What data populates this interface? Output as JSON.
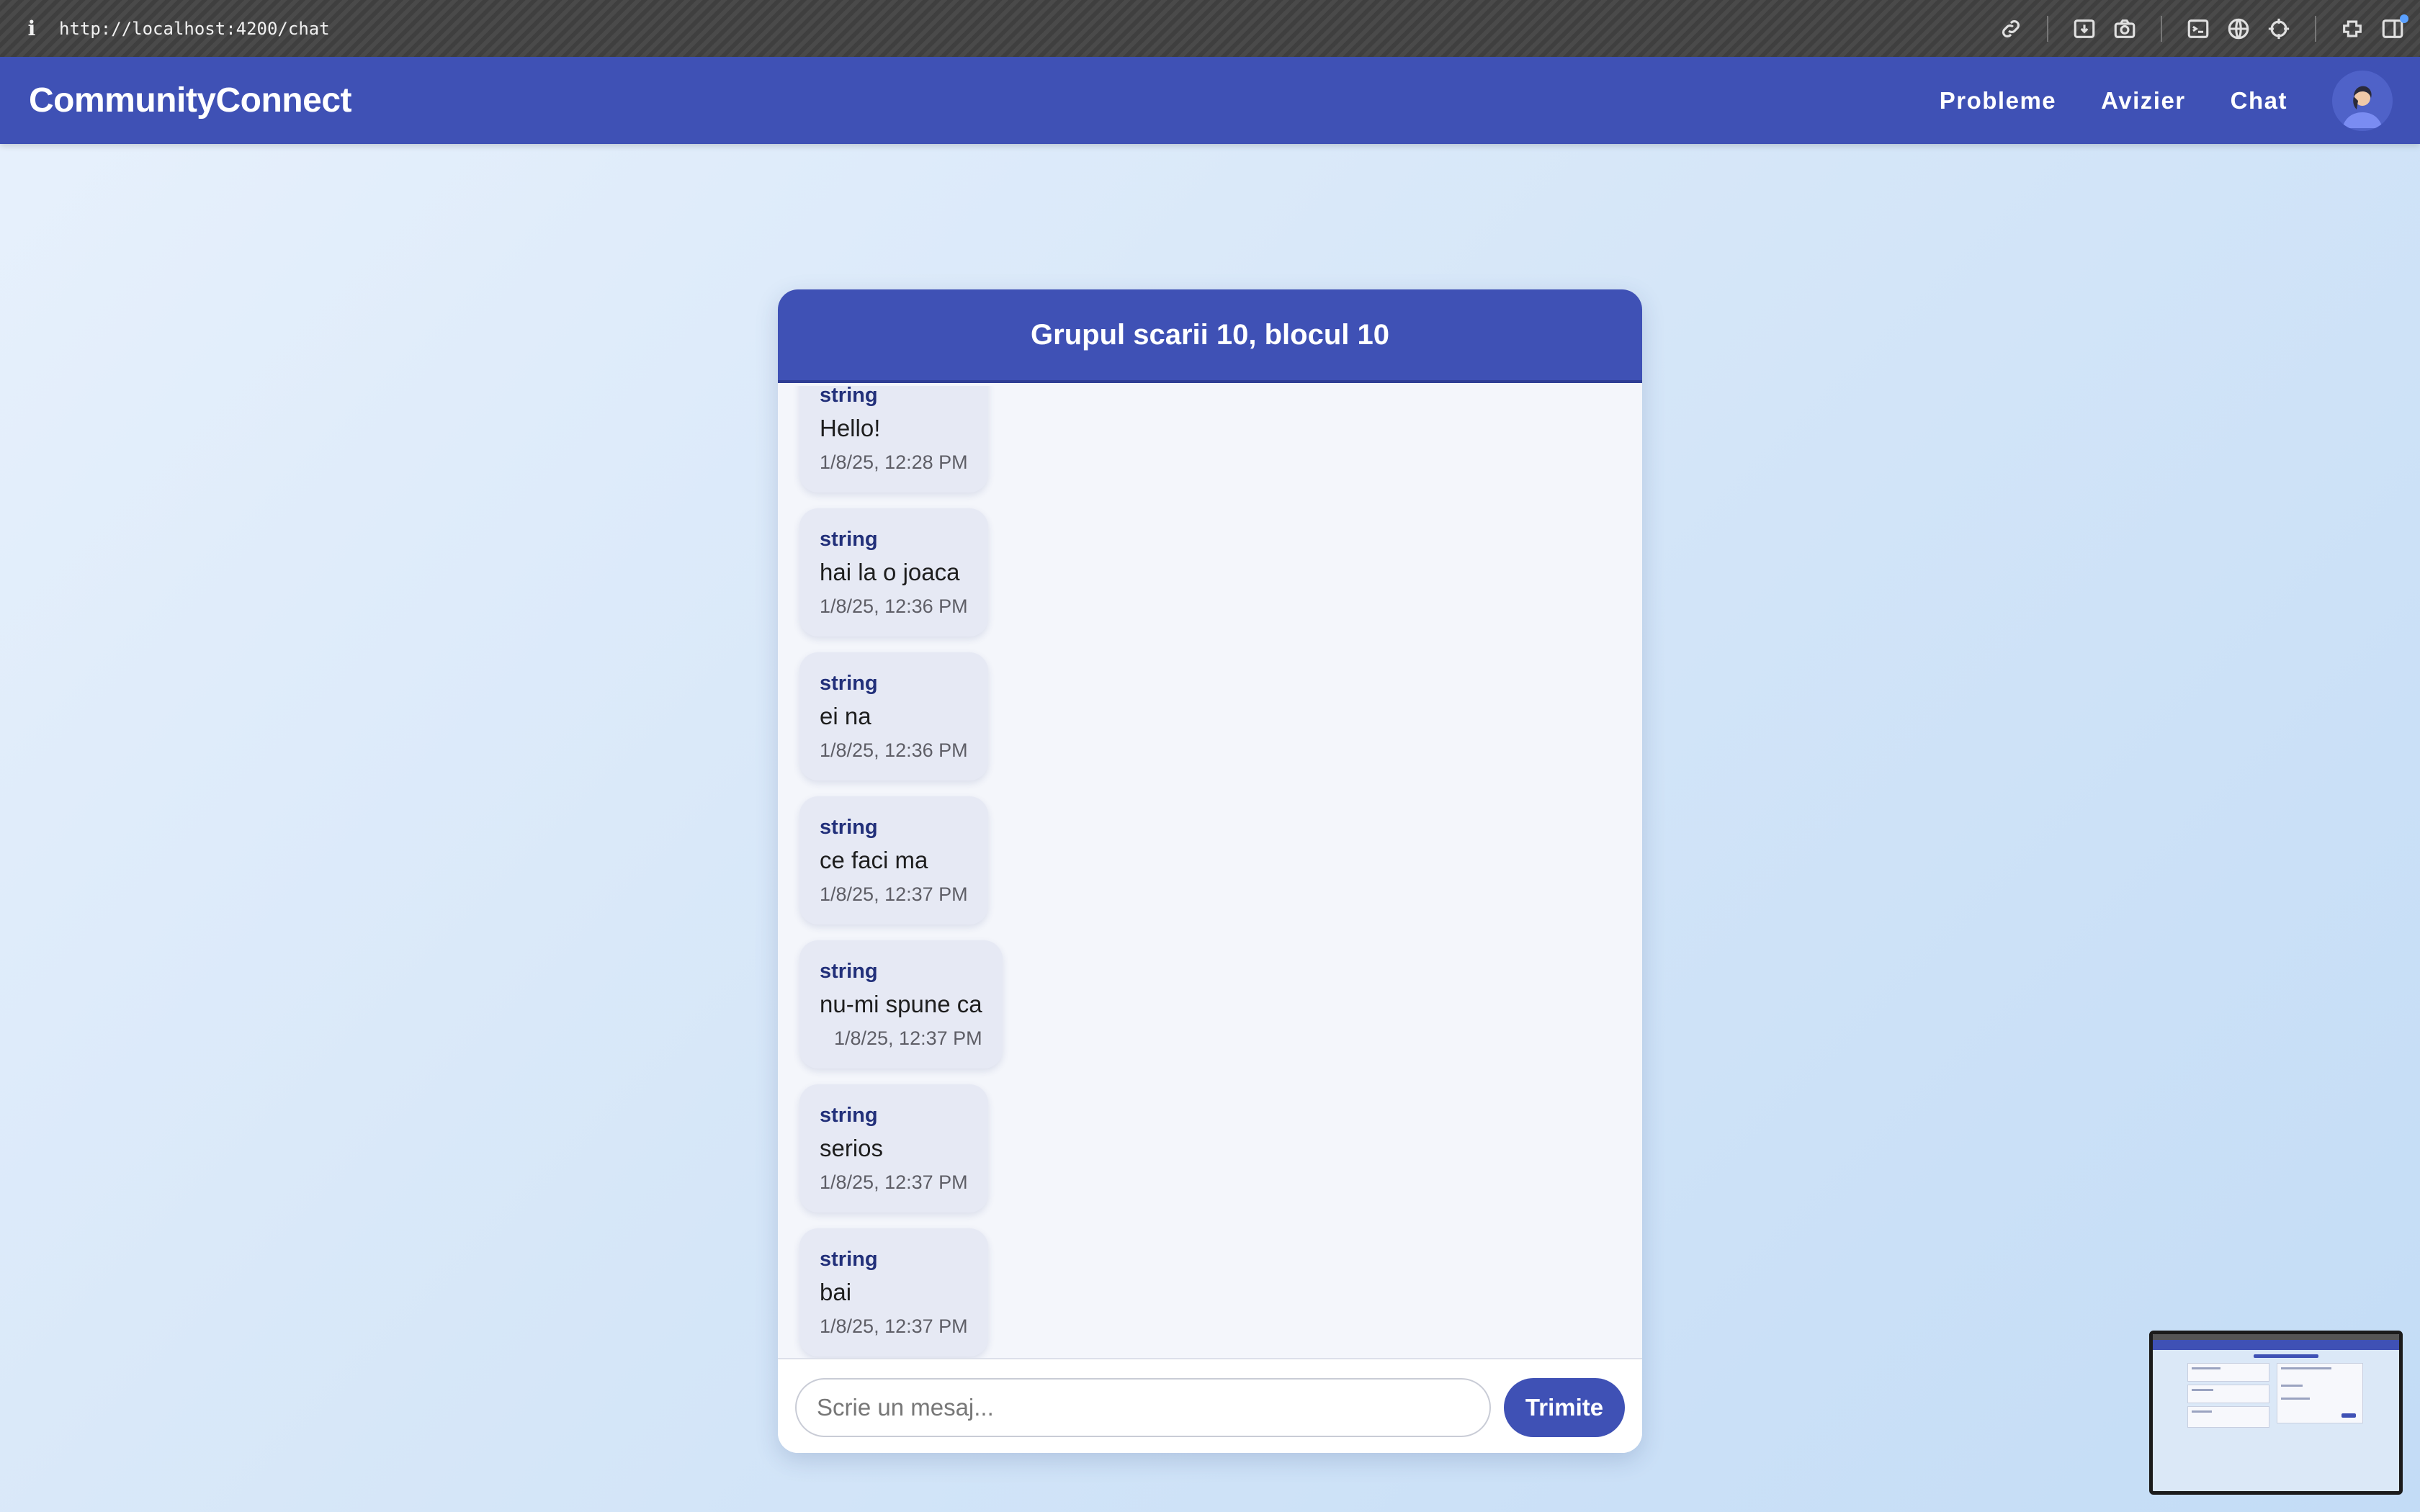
{
  "browser": {
    "url": "http://localhost:4200/chat",
    "info_icon": "i"
  },
  "app": {
    "brand": "CommunityConnect",
    "nav": [
      "Probleme",
      "Avizier",
      "Chat"
    ]
  },
  "chat": {
    "title": "Grupul scarii 10, blocul 10",
    "messages": [
      {
        "sender": "string",
        "text": "Hello!",
        "time": "1/8/25, 12:28 PM"
      },
      {
        "sender": "string",
        "text": "hai la o joaca",
        "time": "1/8/25, 12:36 PM"
      },
      {
        "sender": "string",
        "text": "ei na",
        "time": "1/8/25, 12:36 PM"
      },
      {
        "sender": "string",
        "text": "ce faci ma",
        "time": "1/8/25, 12:37 PM"
      },
      {
        "sender": "string",
        "text": "nu-mi spune ca",
        "time": "1/8/25, 12:37 PM"
      },
      {
        "sender": "string",
        "text": "serios",
        "time": "1/8/25, 12:37 PM"
      },
      {
        "sender": "string",
        "text": "bai",
        "time": "1/8/25, 12:37 PM"
      }
    ],
    "input_placeholder": "Scrie un mesaj...",
    "input_value": "",
    "send_label": "Trimite"
  },
  "colors": {
    "primary": "#3f51b5",
    "sender": "#22307a",
    "bubble": "#e6e9f4"
  }
}
